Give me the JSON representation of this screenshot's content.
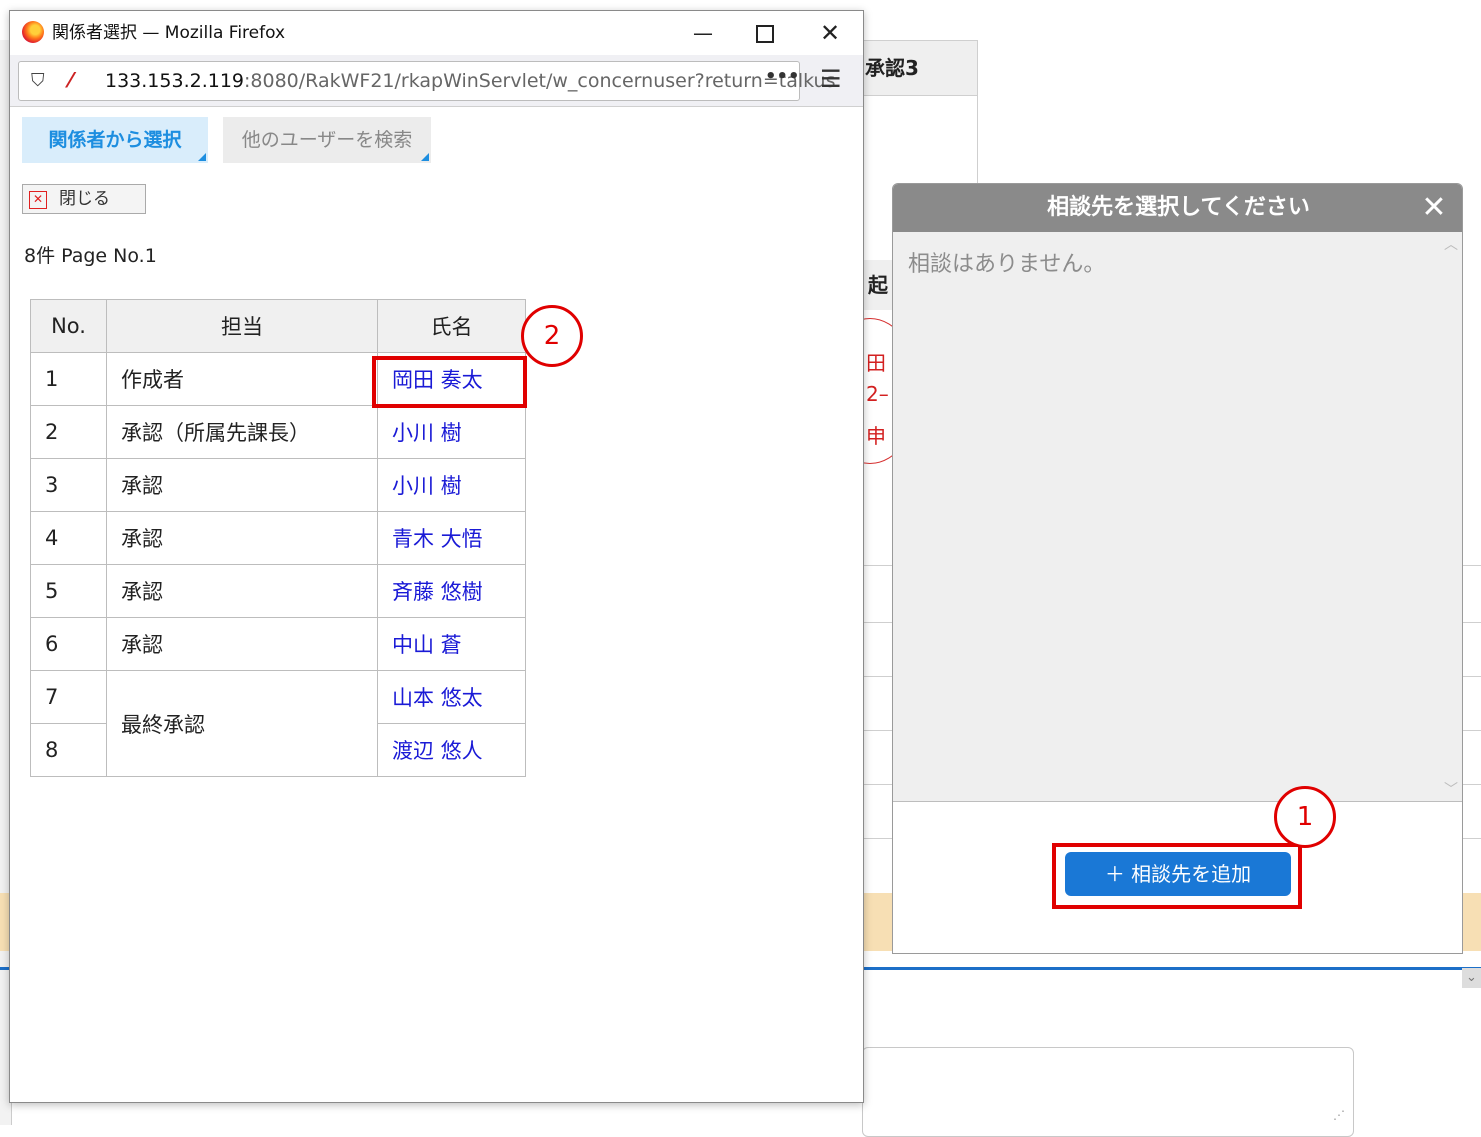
{
  "popup": {
    "title": "関係者選択 — Mozilla Firefox",
    "url_host": "133.153.2.119",
    "url_path": ":8080/RakWF21/rkapWinServlet/w_concernuser?return=talkus",
    "tabs": [
      "関係者から選択",
      "他のユーザーを検索"
    ],
    "close_label": "閉じる",
    "page_info": "8件  Page No.1",
    "table": {
      "headers": [
        "No.",
        "担当",
        "氏名"
      ],
      "rows": [
        {
          "no": "1",
          "role": "作成者",
          "name": "岡田 奏太"
        },
        {
          "no": "2",
          "role": "承認（所属先課長）",
          "name": "小川 樹"
        },
        {
          "no": "3",
          "role": "承認",
          "name": "小川 樹"
        },
        {
          "no": "4",
          "role": "承認",
          "name": "青木 大悟"
        },
        {
          "no": "5",
          "role": "承認",
          "name": "斉藤 悠樹"
        },
        {
          "no": "6",
          "role": "承認",
          "name": "中山 蒼"
        },
        {
          "no": "7",
          "role": "最終承認",
          "name": "山本 悠太"
        },
        {
          "no": "8",
          "role": "最終承認",
          "name": "渡辺 悠人"
        }
      ]
    }
  },
  "consult_dialog": {
    "title": "相談先を選択してください",
    "close_glyph": "✕",
    "empty_text": "相談はありません。",
    "add_button": "＋ 相談先を追加"
  },
  "annotations": {
    "step1": "1",
    "step2": "2"
  },
  "background": {
    "header_cell": "承認3",
    "okoshi_label": "起",
    "stamp_lines": [
      "田",
      "2–",
      "申"
    ]
  },
  "colors": {
    "accent": "#1a78d6",
    "annotation": "#e00000",
    "link": "#1a1ad6"
  }
}
